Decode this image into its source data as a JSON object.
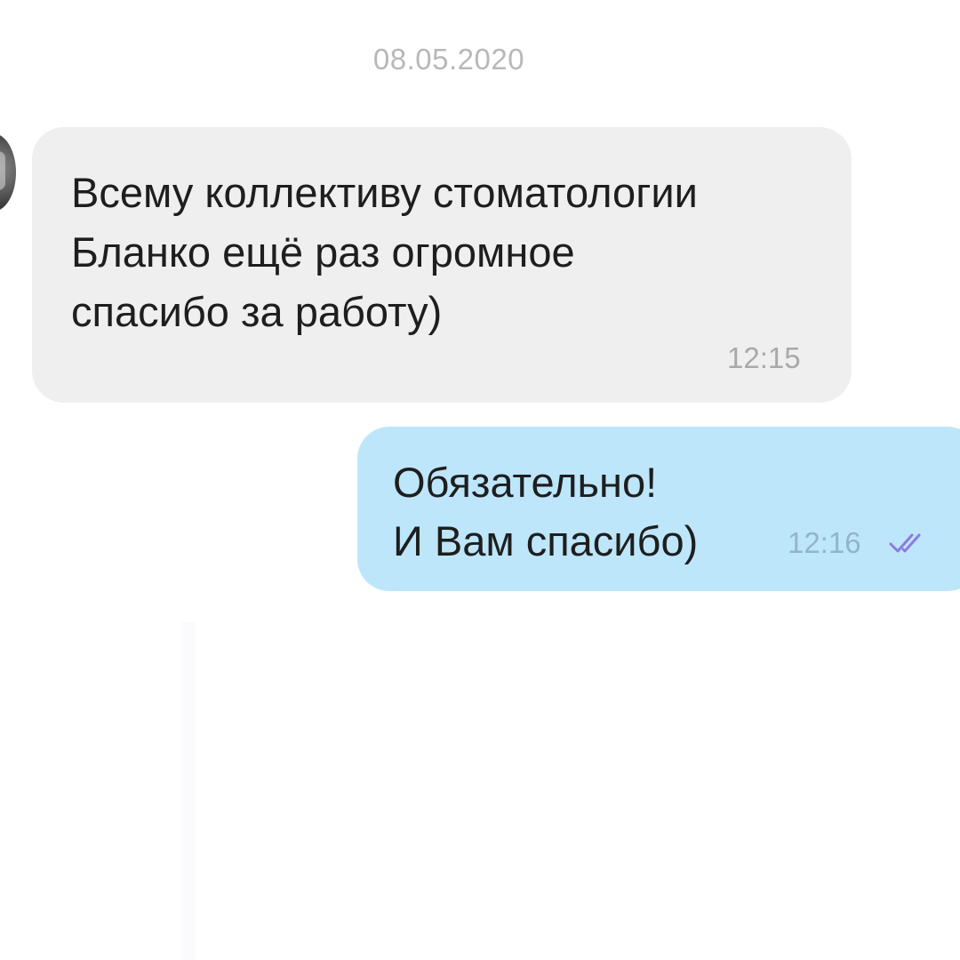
{
  "date_separator": "08.05.2020",
  "messages": [
    {
      "direction": "incoming",
      "lines": [
        "Всему коллективу стоматологии",
        "Бланко ещё раз огромное",
        "спасибо за работу)"
      ],
      "time": "12:15"
    },
    {
      "direction": "outgoing",
      "lines": [
        "Обязательно!",
        "И Вам спасибо)"
      ],
      "time": "12:16",
      "status_icon": "double-check-icon"
    }
  ],
  "colors": {
    "incoming_bubble": "#efefef",
    "outgoing_bubble": "#bde6fb",
    "read_check": "#8e7ae0",
    "timestamp": "#a9a9a9"
  }
}
